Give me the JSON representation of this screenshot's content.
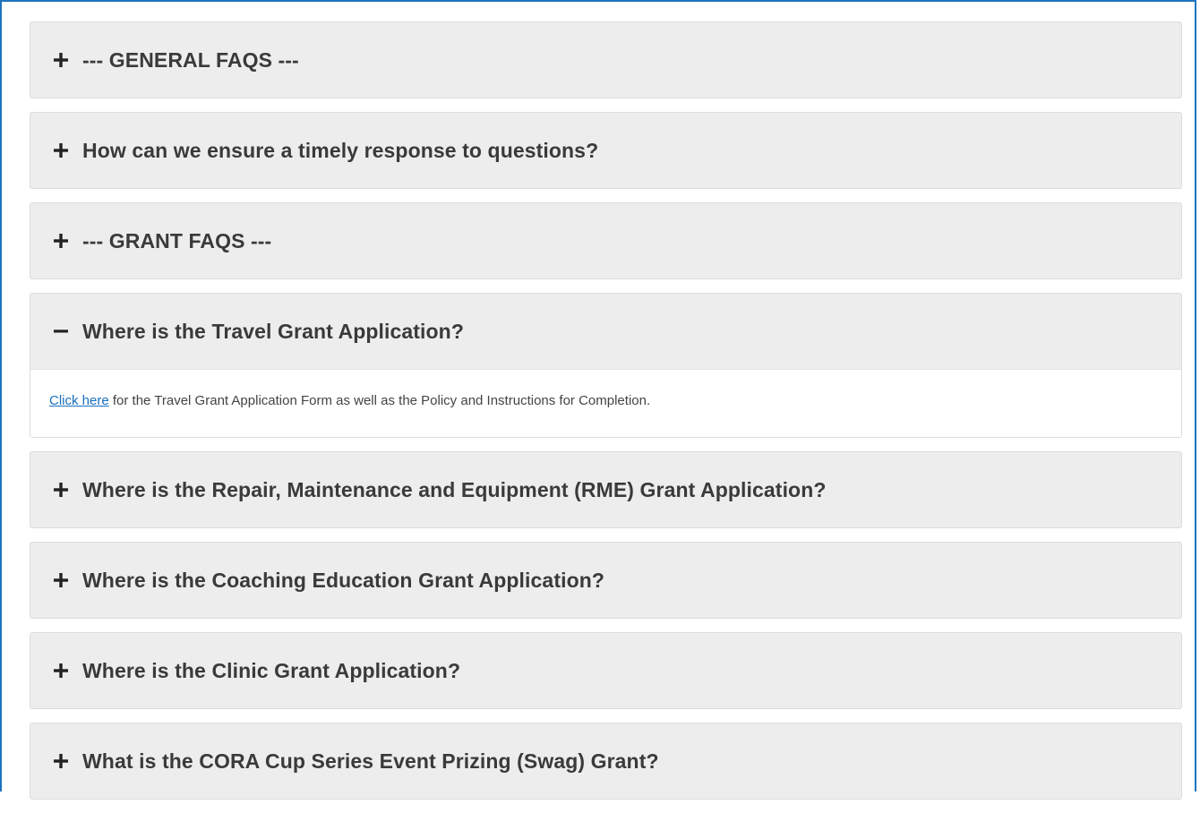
{
  "faq": {
    "items": [
      {
        "title": "--- GENERAL FAQS ---",
        "expanded": false,
        "icon": "plus-icon"
      },
      {
        "title": "How can we ensure a timely response to questions?",
        "expanded": false,
        "icon": "plus-icon"
      },
      {
        "title": "--- GRANT FAQS ---",
        "expanded": false,
        "icon": "plus-icon"
      },
      {
        "title": "Where is the Travel Grant Application?",
        "expanded": true,
        "icon": "minus-icon",
        "body": {
          "link_text": "Click here",
          "text": " for the Travel Grant Application Form as well as the Policy and Instructions for Completion."
        }
      },
      {
        "title": "Where is the Repair, Maintenance and Equipment (RME) Grant Application?",
        "expanded": false,
        "icon": "plus-icon"
      },
      {
        "title": "Where is the Coaching Education Grant Application?",
        "expanded": false,
        "icon": "plus-icon"
      },
      {
        "title": "Where is the Clinic Grant Application?",
        "expanded": false,
        "icon": "plus-icon"
      },
      {
        "title": "What is the CORA Cup Series Event Prizing (Swag) Grant?",
        "expanded": false,
        "icon": "plus-icon"
      }
    ]
  },
  "colors": {
    "frame_border": "#1e73be",
    "panel_bg": "#ededed",
    "title_text": "#3a3a3a",
    "link": "#1a6fbf"
  }
}
